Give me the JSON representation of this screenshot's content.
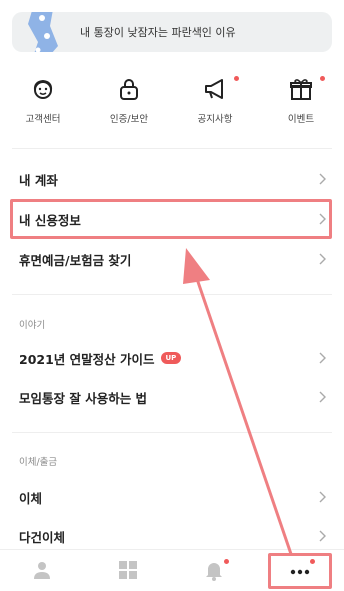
{
  "banner": {
    "text": "내 통장이 낮잠자는 파란색인 이유"
  },
  "quick_menu": [
    {
      "label": "고객센터",
      "icon": "customer-center-icon",
      "dot": false
    },
    {
      "label": "인증/보안",
      "icon": "lock-icon",
      "dot": false
    },
    {
      "label": "공지사항",
      "icon": "megaphone-icon",
      "dot": true
    },
    {
      "label": "이벤트",
      "icon": "gift-icon",
      "dot": true
    }
  ],
  "menu": {
    "my_account": "내 계좌",
    "my_credit": "내 신용정보",
    "dormant": "휴면예금/보험금 찾기",
    "section_story": "이야기",
    "tax_guide": "2021년 연말정산 가이드",
    "tax_guide_badge": "UP",
    "group_account": "모임통장 잘 사용하는 법",
    "section_transfer": "이체/출금",
    "transfer": "이체",
    "multi_transfer": "다건이체"
  },
  "tabbar": [
    {
      "icon": "person-icon"
    },
    {
      "icon": "grid-icon"
    },
    {
      "icon": "bell-icon",
      "dot": true
    },
    {
      "icon": "more-dots-icon",
      "dot": true
    }
  ],
  "colors": {
    "accent_red": "#ef5a5a",
    "highlight": "#ef7f82",
    "divider": "#eeeeee"
  }
}
